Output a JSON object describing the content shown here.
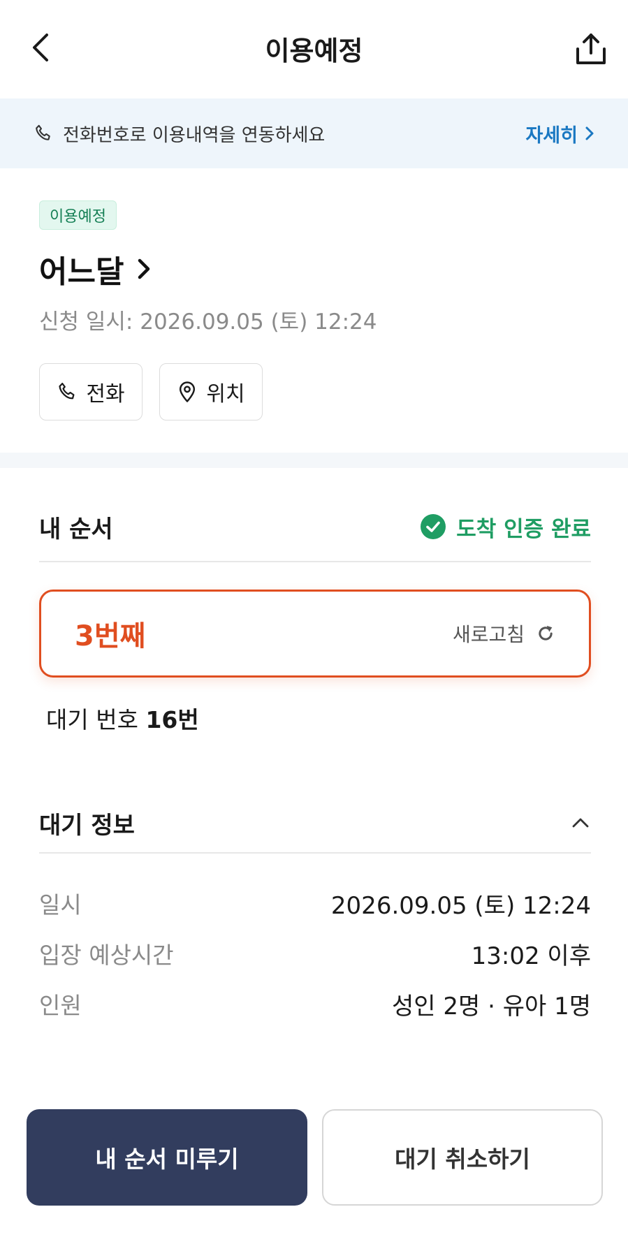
{
  "header": {
    "title": "이용예정",
    "back_icon": "chevron-left-icon",
    "share_icon": "share-icon"
  },
  "banner": {
    "text": "전화번호로 이용내역을 연동하세요",
    "link_label": "자세히",
    "icon": "phone-icon"
  },
  "store": {
    "status_badge": "이용예정",
    "name": "어느달",
    "applied_at": "신청 일시: 2026.09.05 (토) 12:24",
    "call_label": "전화",
    "location_label": "위치"
  },
  "my_order": {
    "title": "내 순서",
    "verify_label": "도착 인증 완료",
    "rank": "3번째",
    "refresh_label": "새로고침",
    "waiting_prefix": "대기 번호",
    "waiting_number": "16번"
  },
  "wait_info": {
    "title": "대기 정보",
    "rows": [
      {
        "label": "일시",
        "value": "2026.09.05 (토) 12:24"
      },
      {
        "label": "입장 예상시간",
        "value": "13:02 이후"
      },
      {
        "label": "인원",
        "value": "성인 2명 · 유아 1명"
      }
    ]
  },
  "actions": {
    "postpone_label": "내 순서 미루기",
    "cancel_label": "대기 취소하기"
  },
  "colors": {
    "accent_orange": "#e04e20",
    "verify_green": "#1f9d63",
    "primary_button": "#323d5e",
    "link_blue": "#1a78c2",
    "banner_bg": "#eef5fb"
  }
}
